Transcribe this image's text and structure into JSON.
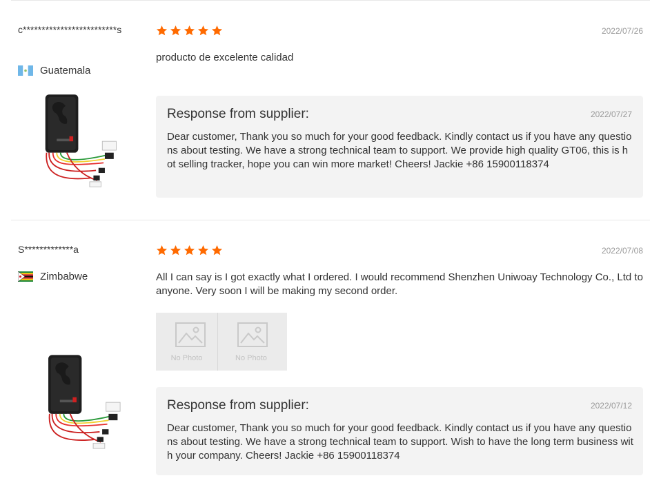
{
  "colors": {
    "star": "#ff6a00",
    "divider": "#e8e8e8",
    "response_bg": "#f3f3f3",
    "date_text": "#999999"
  },
  "reviews": [
    {
      "buyer_name": "c*************************s",
      "country": "Guatemala",
      "flag_icon": "guatemala-flag-icon",
      "rating": 5,
      "date": "2022/07/26",
      "text": "producto de excelente calidad",
      "photos": [],
      "response": {
        "title": "Response from supplier:",
        "date": "2022/07/27",
        "text": "Dear customer, Thank you so much for your good feedback. Kindly contact us if you have any questions about testing. We have a strong technical team to support. We provide high quality GT06, this is hot selling tracker, hope you can win more market! Cheers! Jackie +86 15900118374"
      }
    },
    {
      "buyer_name": "S*************a",
      "country": "Zimbabwe",
      "flag_icon": "zimbabwe-flag-icon",
      "rating": 5,
      "date": "2022/07/08",
      "text": "All I can say is I got exactly what I ordered. I would recommend Shenzhen Uniwoay Technology Co., Ltd to anyone. Very soon I will be making my second order.",
      "photos": [
        {
          "label": "No Photo"
        },
        {
          "label": "No Photo"
        }
      ],
      "response": {
        "title": "Response from supplier:",
        "date": "2022/07/12",
        "text": "Dear customer, Thank you so much for your good feedback. Kindly contact us if you have any questions about testing. We have a strong technical team to support. Wish to have the long term business with your company. Cheers! Jackie +86 15900118374"
      }
    }
  ]
}
